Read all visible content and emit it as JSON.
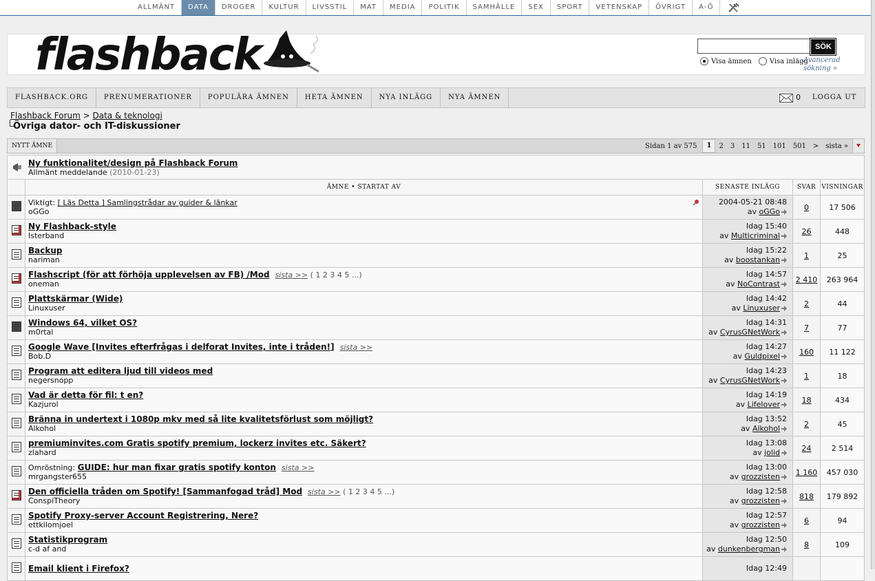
{
  "topnav": [
    "ALLMÄNT",
    "DATA",
    "DROGER",
    "KULTUR",
    "LIVSSTIL",
    "MAT",
    "MEDIA",
    "POLITIK",
    "SAMHÄLLE",
    "SEX",
    "SPORT",
    "VETENSKAP",
    "ÖVRIGT",
    "A-Ö"
  ],
  "topnav_active": "DATA",
  "brand": "flashback",
  "search": {
    "button": "SÖK",
    "value": "",
    "radio_topics": "Visa ämnen",
    "radio_posts": "Visa inlägg",
    "advanced_line1": "Avancerad",
    "advanced_line2": "sökning »"
  },
  "mainnav": [
    "FLASHBACK.ORG",
    "PRENUMERATIONER",
    "POPULÄRA ÄMNEN",
    "HETA ÄMNEN",
    "NYA INLÄGG",
    "NYA ÄMNEN"
  ],
  "mail_count": "0",
  "logout": "LOGGA UT",
  "breadcrumb": {
    "root": "Flashback Forum",
    "sep": ">",
    "section": "Data & teknologi"
  },
  "page_title": "Övriga dator- och IT-diskussioner",
  "pager": {
    "new_topic": "NYTT ÄMNE",
    "info": "Sidan 1 av 575",
    "pages": [
      "1",
      "2",
      "3",
      "11",
      "51",
      "101",
      "501",
      ">",
      "sista »"
    ]
  },
  "announcement": {
    "title": "Ny funktionalitet/design på Flashback Forum",
    "label": "Allmänt meddelande",
    "date": "(2010-01-23)"
  },
  "columns": {
    "topic": "ÄMNE • STARTAT AV",
    "last": "SENASTE INLÄGG",
    "replies": "SVAR",
    "views": "VISNINGAR"
  },
  "threads": [
    {
      "prefix": "Viktigt:",
      "title": "[ Läs Detta ] Samlingstrådar av guider & länkar",
      "author": "oGGo",
      "last_time": "2004-05-21 08:48",
      "last_user": "oGGo",
      "replies": "0",
      "views": "17 506",
      "sista": "",
      "pages": "",
      "bold": false,
      "icon": "lock",
      "pinned": true
    },
    {
      "prefix": "",
      "title": "Ny Flashback-style",
      "author": "Isterband",
      "last_time": "Idag 15:40",
      "last_user": "Multicriminal",
      "replies": "26",
      "views": "448",
      "sista": "",
      "pages": "",
      "bold": true,
      "icon": "hot",
      "pinned": false
    },
    {
      "prefix": "",
      "title": "Backup",
      "author": "nariman",
      "last_time": "Idag 15:22",
      "last_user": "boostankan",
      "replies": "1",
      "views": "25",
      "sista": "",
      "pages": "",
      "bold": true,
      "icon": "normal",
      "pinned": false
    },
    {
      "prefix": "",
      "title": "Flashscript (för att förhöja upplevelsen av FB) /Mod",
      "author": "oneman",
      "last_time": "Idag 14:57",
      "last_user": "NoContrast",
      "replies": "2 410",
      "views": "263 964",
      "sista": "sista >>",
      "pages": "( 1 2 3 4 5 ...)",
      "bold": true,
      "icon": "hot",
      "pinned": false
    },
    {
      "prefix": "",
      "title": "Plattskärmar (Wide)",
      "author": "Linuxuser",
      "last_time": "Idag 14:42",
      "last_user": "Linuxuser",
      "replies": "2",
      "views": "44",
      "sista": "",
      "pages": "",
      "bold": true,
      "icon": "normal",
      "pinned": false
    },
    {
      "prefix": "",
      "title": "Windows 64, vilket OS?",
      "author": "m0rtal",
      "last_time": "Idag 14:31",
      "last_user": "CyrusGNetWork",
      "replies": "7",
      "views": "77",
      "sista": "",
      "pages": "",
      "bold": true,
      "icon": "lock",
      "pinned": false
    },
    {
      "prefix": "",
      "title": "Google Wave [Invites efterfrågas i delforat Invites, inte i tråden!]",
      "author": "Bob.D",
      "last_time": "Idag 14:27",
      "last_user": "Guldpixel",
      "replies": "160",
      "views": "11 122",
      "sista": "sista >>",
      "pages": "",
      "bold": true,
      "icon": "normal",
      "pinned": false
    },
    {
      "prefix": "",
      "title": "Program att editera ljud till videos med",
      "author": "negersnopp",
      "last_time": "Idag 14:23",
      "last_user": "CyrusGNetWork",
      "replies": "1",
      "views": "18",
      "sista": "",
      "pages": "",
      "bold": true,
      "icon": "normal",
      "pinned": false
    },
    {
      "prefix": "",
      "title": "Vad är detta för fil: t en?",
      "author": "Kazjurol",
      "last_time": "Idag 14:19",
      "last_user": "Lifelover",
      "replies": "18",
      "views": "434",
      "sista": "",
      "pages": "",
      "bold": true,
      "icon": "normal",
      "pinned": false
    },
    {
      "prefix": "",
      "title": "Bränna in undertext i 1080p mkv med så lite kvalitetsförlust som möjligt?",
      "author": "Alkohol",
      "last_time": "Idag 13:52",
      "last_user": "Alkohol",
      "replies": "2",
      "views": "45",
      "sista": "",
      "pages": "",
      "bold": true,
      "icon": "normal",
      "pinned": false
    },
    {
      "prefix": "",
      "title": "premiuminvites.com Gratis spotify premium, lockerz invites etc. Säkert?",
      "author": "zlahard",
      "last_time": "Idag 13:08",
      "last_user": "jolid",
      "replies": "24",
      "views": "2 514",
      "sista": "",
      "pages": "",
      "bold": true,
      "icon": "normal",
      "pinned": false
    },
    {
      "prefix": "Omröstning:",
      "title": "GUIDE: hur man fixar gratis spotify konton",
      "author": "mrgangster655",
      "last_time": "Idag 13:00",
      "last_user": "grozzisten",
      "replies": "1 160",
      "views": "457 030",
      "sista": "sista >>",
      "pages": "",
      "bold": true,
      "icon": "normal",
      "pinned": false
    },
    {
      "prefix": "",
      "title": "Den officiella tråden om Spotify! [Sammanfogad tråd] Mod",
      "author": "ConspiTheory",
      "last_time": "Idag 12:58",
      "last_user": "grozzisten",
      "replies": "818",
      "views": "179 892",
      "sista": "sista >>",
      "pages": "( 1 2 3 4 5 ...)",
      "bold": true,
      "icon": "hot",
      "pinned": false
    },
    {
      "prefix": "",
      "title": "Spotify Proxy-server Account Registrering, Nere?",
      "author": "ettkilomjoel",
      "last_time": "Idag 12:57",
      "last_user": "grozzisten",
      "replies": "6",
      "views": "94",
      "sista": "",
      "pages": "",
      "bold": true,
      "icon": "normal",
      "pinned": false
    },
    {
      "prefix": "",
      "title": "Statistikprogram",
      "author": "c-d af and",
      "last_time": "Idag 12:50",
      "last_user": "dunkenbergman",
      "replies": "8",
      "views": "109",
      "sista": "",
      "pages": "",
      "bold": true,
      "icon": "normal",
      "pinned": false
    },
    {
      "prefix": "",
      "title": "Email klient i Firefox?",
      "author": "",
      "last_time": "Idag 12:49",
      "last_user": "",
      "replies": "",
      "views": "",
      "sista": "",
      "pages": "",
      "bold": true,
      "icon": "normal",
      "pinned": false
    }
  ],
  "prefix_by": "av"
}
